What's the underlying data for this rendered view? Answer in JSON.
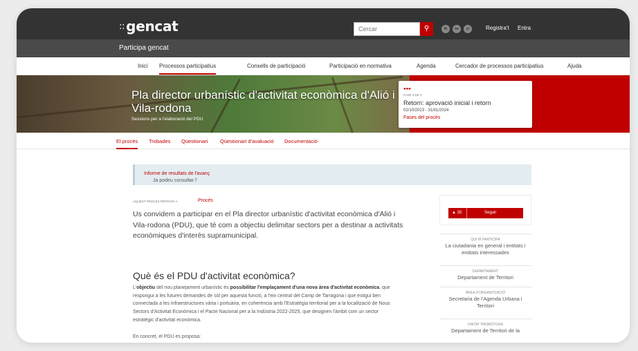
{
  "header": {
    "logo_mark": "::",
    "logo_text": "gencat",
    "search_placeholder": "Cercar",
    "search_icon": "search-icon",
    "social": [
      "fb",
      "tw",
      "yt"
    ],
    "register": "Registra't",
    "login": "Entra"
  },
  "subheader": {
    "title": "Participa gencat"
  },
  "nav": {
    "items": [
      {
        "label": "Inici"
      },
      {
        "label": "Processos participatius"
      },
      {
        "label": "Consells de participació"
      },
      {
        "label": "Participació en normativa"
      },
      {
        "label": "Agenda"
      },
      {
        "label": "Cercador de processos participatius"
      },
      {
        "label": "Ajuda"
      }
    ],
    "active_index": 1
  },
  "hero": {
    "title": "Pla director urbanístic d'activitat econòmica d'Alió i Vila-rodona",
    "subtitle": "Sessions per a l'elaboració del PDU",
    "accent_color": "#c00000"
  },
  "phase": {
    "dots": "●-●-●",
    "label": "FASE 3 DE 3",
    "title": "Retorn: aprovació inicial i retorn",
    "dates": "02/10/2023 - 31/01/2024",
    "link": "Fases del procés"
  },
  "subnav": {
    "items": [
      {
        "label": "El procés"
      },
      {
        "label": "Trobades"
      },
      {
        "label": "Qüestionari"
      },
      {
        "label": "Qüestionari d'avaluació"
      },
      {
        "label": "Documentació"
      }
    ],
    "active_index": 0
  },
  "callout": {
    "prefix": "Ja podeu consultar l'",
    "link": "Informe de resultats de l'avanç",
    "suffix": " .",
    "link_icon": "external-link-icon"
  },
  "main": {
    "belongs_label": "AQUEST PROCÉS PERTANY A",
    "belongs_link": "Procés",
    "intro": "Us convidem a participar en el Pla director urbanístic d'activitat econòmica d'Alió i Vila-rodona (PDU), que té com a objectiu delimitar sectors per a destinar a activitats econòmiques d'interès supramunicipal.",
    "section_title": "Què és el PDU d'activitat econòmica?",
    "p1_a": "L'",
    "p1_b": "objectiu",
    "p1_c": " del nou planejament urbanístic és ",
    "p1_d": "possibilitar l'emplaçament d'una nova àrea d'activitat econòmica",
    "p1_e": ", que respongui a les futures demandes de sòl per aquesta funció, a l'eix central del Camp de Tarragona i que estigui ben connectada a les infraestructures vària i portuària, en coherència amb l'Estratègia territorial per a la localització de Nous Sectors d'Activitat Econòmica i el Pacte Nacional per a la Indústria 2022-2025, que designen l'àmbit com un sector estratègic d'activitat econòmica.",
    "p2": "En concret, el PDU es proposa:"
  },
  "sidebar": {
    "follow_count": "▲ 35",
    "follow_label": "Seguir",
    "meta": [
      {
        "label": "Qui hi participa",
        "value": "La ciutadania en general i entitats i entitats interessades"
      },
      {
        "label": "Departament",
        "value": "Departament de Territori"
      },
      {
        "label": "Àrea d'organització",
        "value": "Secretaria de l'Agenda Urbana i Territori"
      },
      {
        "label": "Unitat promotora",
        "value": "Departament de Territori de la"
      }
    ]
  }
}
